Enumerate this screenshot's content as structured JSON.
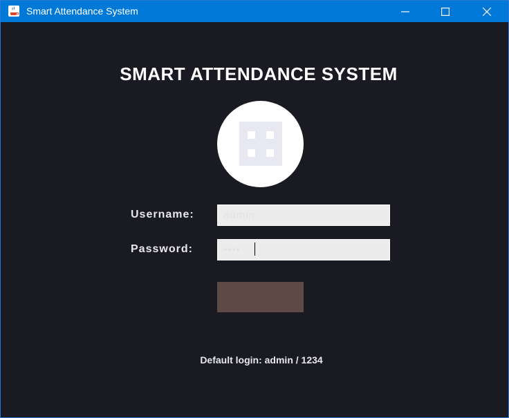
{
  "window": {
    "title": "Smart Attendance System",
    "titlebar_color": "#0078d7",
    "background_color": "#1a1a22"
  },
  "heading": "SMART ATTENDANCE SYSTEM",
  "logo": {
    "icon": "grid-logo-icon"
  },
  "form": {
    "username_label": "Username:",
    "username_value": "admin",
    "password_label": "Password:",
    "password_value": "1234",
    "login_button_label": "",
    "login_button_color": "#5e4a47"
  },
  "hint": "Default login: admin / 1234"
}
